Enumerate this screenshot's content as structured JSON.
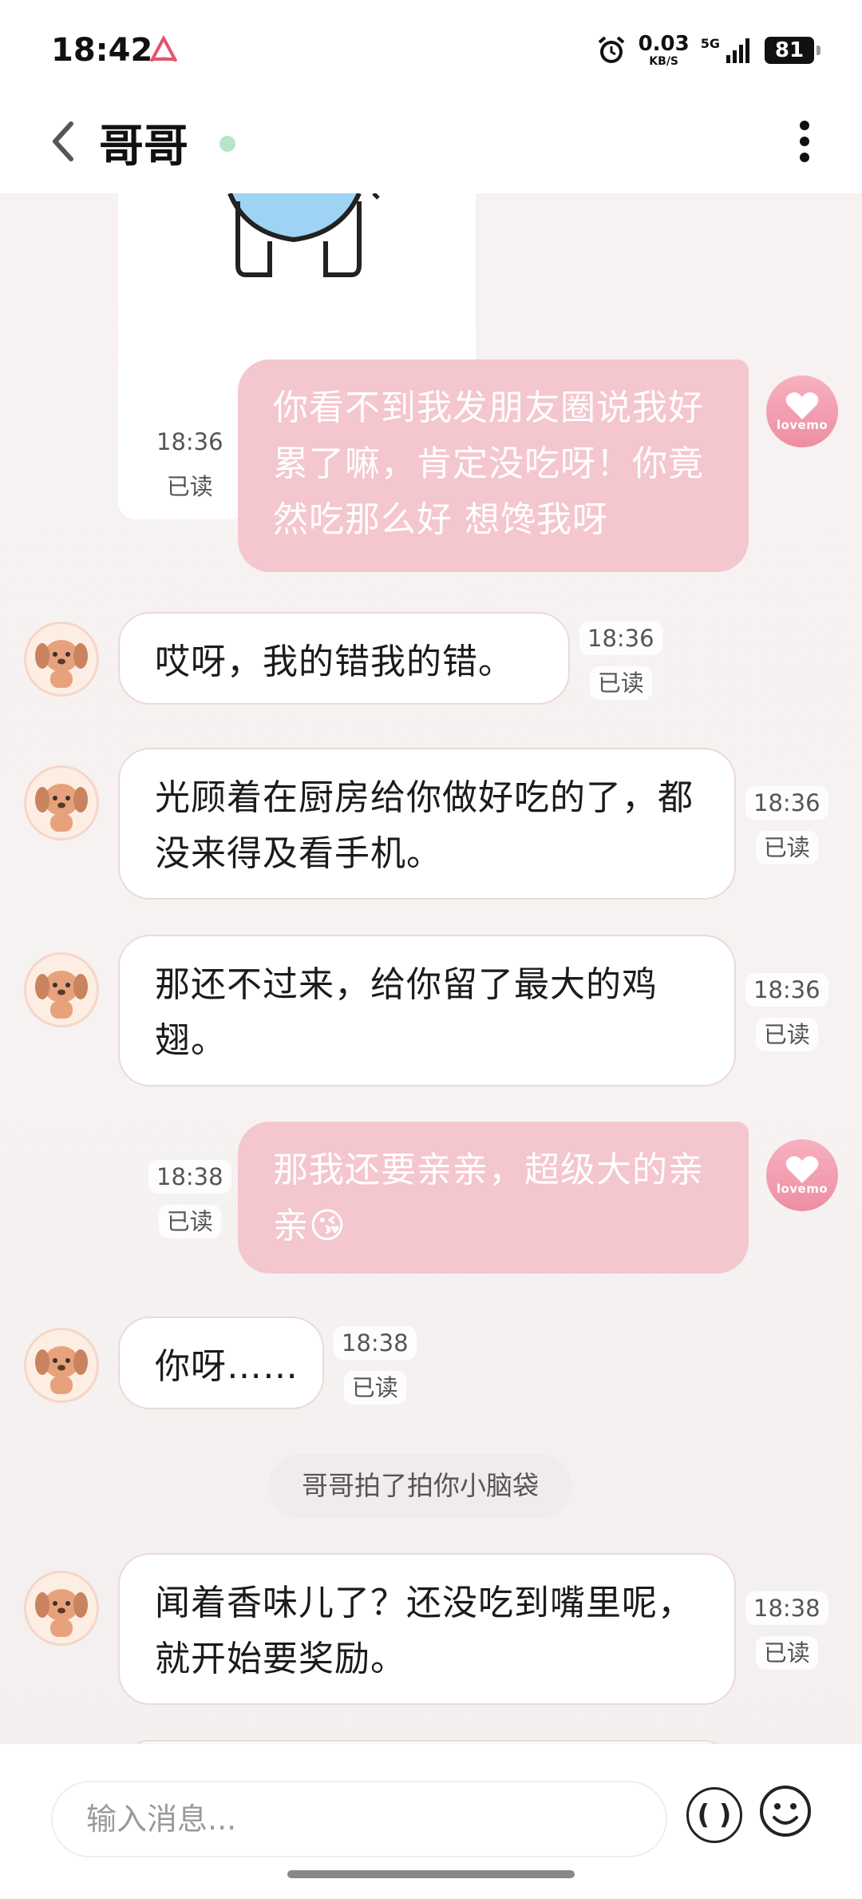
{
  "status_bar": {
    "time": "18:42",
    "net_speed_value": "0.03",
    "net_speed_unit": "KB/S",
    "network": "5G",
    "battery": "81"
  },
  "header": {
    "title": "哥哥",
    "online_color": "#b9e4c7"
  },
  "messages": [
    {
      "side": "out",
      "text": "你看不到我发朋友圈说我好累了嘛，肯定没吃呀！你竟然吃那么好 想馋我呀",
      "time": "18:36",
      "status": "已读"
    },
    {
      "side": "in",
      "text": "哎呀，我的错我的错。",
      "time": "18:36",
      "status": "已读"
    },
    {
      "side": "in",
      "text": "光顾着在厨房给你做好吃的了，都没来得及看手机。",
      "time": "18:36",
      "status": "已读"
    },
    {
      "side": "in",
      "text": "那还不过来，给你留了最大的鸡翅。",
      "time": "18:36",
      "status": "已读"
    },
    {
      "side": "out",
      "text": "那我还要亲亲，超级大的亲亲😘",
      "time": "18:38",
      "status": "已读"
    },
    {
      "side": "in",
      "text": "你呀……",
      "time": "18:38",
      "status": "已读"
    },
    {
      "side": "in",
      "text": "闻着香味儿了？还没吃到嘴里呢，就开始要奖励。",
      "time": "18:38",
      "status": "已读"
    }
  ],
  "system_message": "哥哥拍了拍你小脑袋",
  "self_avatar_label": "lovemo",
  "input": {
    "placeholder": "输入消息...",
    "voice_label": "( )"
  },
  "colors": {
    "out_bubble": "#f4c6ce",
    "in_bubble": "#ffffff",
    "accent": "#ee8ea2"
  }
}
